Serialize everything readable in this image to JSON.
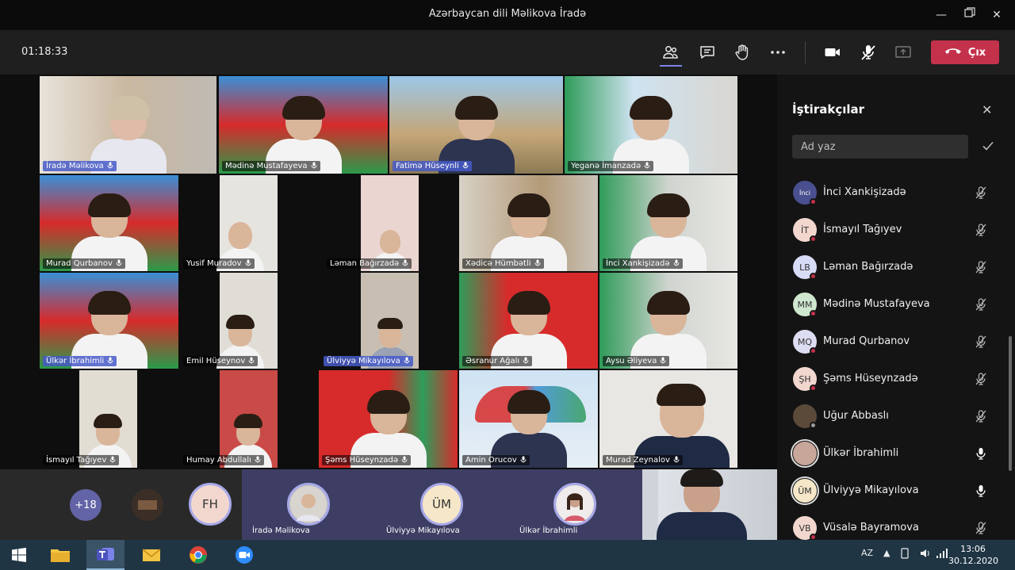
{
  "window": {
    "title": "Azərbaycan dili Məlikova İradə"
  },
  "toolbar": {
    "timer": "01:18:33",
    "leave_label": "Çıx"
  },
  "tiles": [
    {
      "name": "İradə Məlikova",
      "active": true
    },
    {
      "name": "Mədinə Mustafayeva",
      "active": false
    },
    {
      "name": "Fatimə Hüseynli",
      "active": true
    },
    {
      "name": "Yeganə İmanzadə",
      "active": false
    },
    {
      "name": "Murad Qurbanov",
      "active": false
    },
    {
      "name": "Yusif Muradov",
      "active": false
    },
    {
      "name": "Ləman Bağırzadə",
      "active": false
    },
    {
      "name": "Xədicə Hümbətli",
      "active": false
    },
    {
      "name": "İnci Xankişizadə",
      "active": false
    },
    {
      "name": "Ülkər İbrahimli",
      "active": true
    },
    {
      "name": "Emil Hüseynov",
      "active": false
    },
    {
      "name": "Ülviyyə Mikayılova",
      "active": true
    },
    {
      "name": "Əsranur Ağalı",
      "active": false
    },
    {
      "name": "Aysu Əliyeva",
      "active": false
    },
    {
      "name": "İsmayıl Tağıyev",
      "active": false
    },
    {
      "name": "Humay Abdullalı",
      "active": false
    },
    {
      "name": "Şəms Hüseynzadə",
      "active": false
    },
    {
      "name": "Amin Orucov",
      "active": false
    },
    {
      "name": "Murad Zeynalov",
      "active": false
    }
  ],
  "strip": {
    "more_count": "+18",
    "fh_initials": "FH",
    "um_initials": "ÜM",
    "names": [
      "İradə Məlikova",
      "Ülviyyə Mikayılova",
      "Ülkər İbrahimli"
    ]
  },
  "panel": {
    "title": "İştirakçılar",
    "search_placeholder": "Ad yaz",
    "participants": [
      {
        "initials": "İnci",
        "name": "İnci Xankişizadə",
        "mic": "muted",
        "status": "red",
        "avatar": "#4a4f8f"
      },
      {
        "initials": "İT",
        "name": "İsmayıl Tağıyev",
        "mic": "muted",
        "status": "red",
        "avatar": "#f2d7cf"
      },
      {
        "initials": "LB",
        "name": "Ləman Bağırzadə",
        "mic": "muted",
        "status": "red",
        "avatar": "#d8dbf5"
      },
      {
        "initials": "MM",
        "name": "Mədinə Mustafayeva",
        "mic": "muted",
        "status": "red",
        "avatar": "#cfe6cf"
      },
      {
        "initials": "MQ",
        "name": "Murad Qurbanov",
        "mic": "muted",
        "status": "red",
        "avatar": "#dcdcf2"
      },
      {
        "initials": "ŞH",
        "name": "Şəms Hüseynzadə",
        "mic": "muted",
        "status": "red",
        "avatar": "#f2d7cf"
      },
      {
        "initials": "",
        "name": "Uğur Abbaslı",
        "mic": "muted",
        "status": "grey",
        "avatar": "#5b4a3a"
      },
      {
        "initials": "",
        "name": "Ülkər İbrahimli",
        "mic": "on",
        "status": "none",
        "avatar": "#c9a69a"
      },
      {
        "initials": "ÜM",
        "name": "Ülviyyə Mikayılova",
        "mic": "on",
        "status": "none",
        "avatar": "#f6e7c8"
      },
      {
        "initials": "VB",
        "name": "Vüsalə Bayramova",
        "mic": "muted",
        "status": "red",
        "avatar": "#f2d7cf"
      }
    ]
  },
  "taskbar": {
    "lang": "AZ",
    "time": "13:06",
    "date": "30.12.2020"
  },
  "colors": {
    "accent": "#7b83eb",
    "leave": "#c4314b",
    "panel_bg": "#141414"
  }
}
